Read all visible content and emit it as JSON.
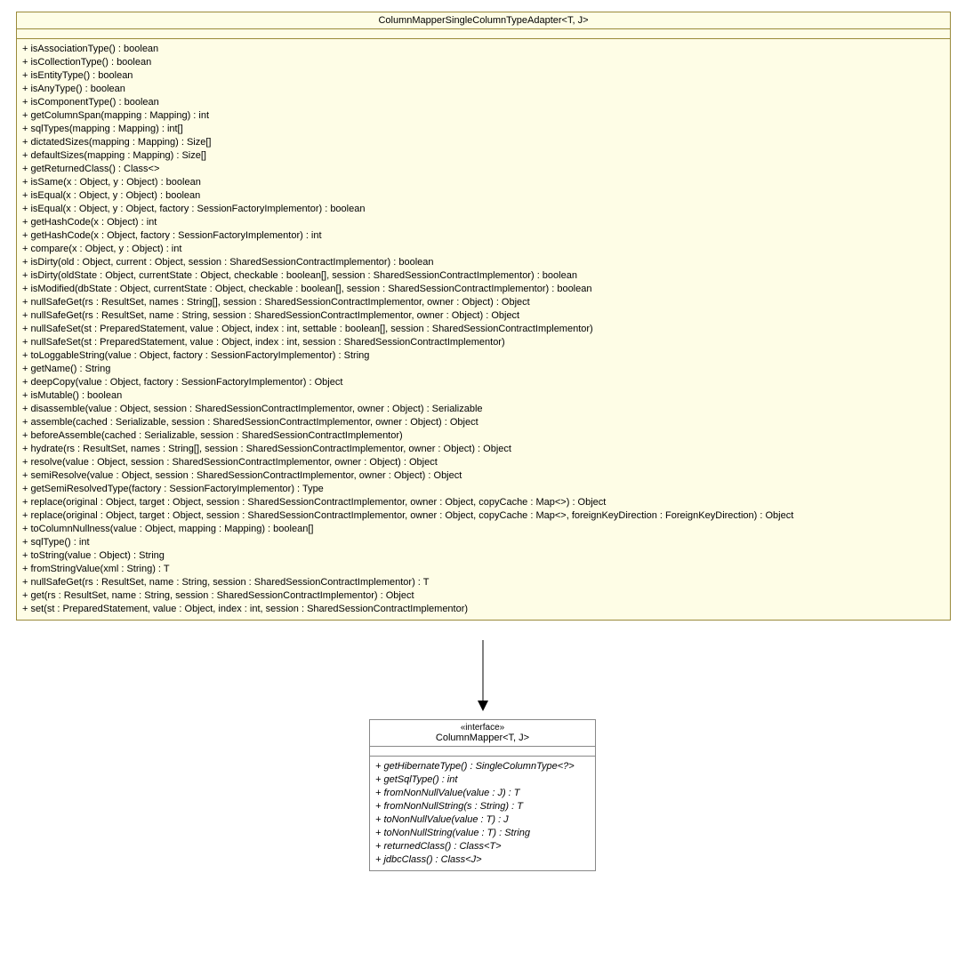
{
  "classBox": {
    "title": "ColumnMapperSingleColumnTypeAdapter<T, J>",
    "methods": [
      "+ isAssociationType() : boolean",
      "+ isCollectionType() : boolean",
      "+ isEntityType() : boolean",
      "+ isAnyType() : boolean",
      "+ isComponentType() : boolean",
      "+ getColumnSpan(mapping : Mapping) : int",
      "+ sqlTypes(mapping : Mapping) : int[]",
      "+ dictatedSizes(mapping : Mapping) : Size[]",
      "+ defaultSizes(mapping : Mapping) : Size[]",
      "+ getReturnedClass() : Class<>",
      "+ isSame(x : Object, y : Object) : boolean",
      "+ isEqual(x : Object, y : Object) : boolean",
      "+ isEqual(x : Object, y : Object, factory : SessionFactoryImplementor) : boolean",
      "+ getHashCode(x : Object) : int",
      "+ getHashCode(x : Object, factory : SessionFactoryImplementor) : int",
      "+ compare(x : Object, y : Object) : int",
      "+ isDirty(old : Object, current : Object, session : SharedSessionContractImplementor) : boolean",
      "+ isDirty(oldState : Object, currentState : Object, checkable : boolean[], session : SharedSessionContractImplementor) : boolean",
      "+ isModified(dbState : Object, currentState : Object, checkable : boolean[], session : SharedSessionContractImplementor) : boolean",
      "+ nullSafeGet(rs : ResultSet, names : String[], session : SharedSessionContractImplementor, owner : Object) : Object",
      "+ nullSafeGet(rs : ResultSet, name : String, session : SharedSessionContractImplementor, owner : Object) : Object",
      "+ nullSafeSet(st : PreparedStatement, value : Object, index : int, settable : boolean[], session : SharedSessionContractImplementor)",
      "+ nullSafeSet(st : PreparedStatement, value : Object, index : int, session : SharedSessionContractImplementor)",
      "+ toLoggableString(value : Object, factory : SessionFactoryImplementor) : String",
      "+ getName() : String",
      "+ deepCopy(value : Object, factory : SessionFactoryImplementor) : Object",
      "+ isMutable() : boolean",
      "+ disassemble(value : Object, session : SharedSessionContractImplementor, owner : Object) : Serializable",
      "+ assemble(cached : Serializable, session : SharedSessionContractImplementor, owner : Object) : Object",
      "+ beforeAssemble(cached : Serializable, session : SharedSessionContractImplementor)",
      "+ hydrate(rs : ResultSet, names : String[], session : SharedSessionContractImplementor, owner : Object) : Object",
      "+ resolve(value : Object, session : SharedSessionContractImplementor, owner : Object) : Object",
      "+ semiResolve(value : Object, session : SharedSessionContractImplementor, owner : Object) : Object",
      "+ getSemiResolvedType(factory : SessionFactoryImplementor) : Type",
      "+ replace(original : Object, target : Object, session : SharedSessionContractImplementor, owner : Object, copyCache : Map<>) : Object",
      "+ replace(original : Object, target : Object, session : SharedSessionContractImplementor, owner : Object, copyCache : Map<>, foreignKeyDirection : ForeignKeyDirection) : Object",
      "+ toColumnNullness(value : Object, mapping : Mapping) : boolean[]",
      "+ sqlType() : int",
      "+ toString(value : Object) : String",
      "+ fromStringValue(xml : String) : T",
      "+ nullSafeGet(rs : ResultSet, name : String, session : SharedSessionContractImplementor) : T",
      "+ get(rs : ResultSet, name : String, session : SharedSessionContractImplementor) : Object",
      "+ set(st : PreparedStatement, value : Object, index : int, session : SharedSessionContractImplementor)"
    ]
  },
  "interfaceBox": {
    "stereotype": "«interface»",
    "title": "ColumnMapper<T, J>",
    "methods": [
      "+ getHibernateType() : SingleColumnType<?>",
      "+ getSqlType() : int",
      "+ fromNonNullValue(value : J) : T",
      "+ fromNonNullString(s : String) : T",
      "+ toNonNullValue(value : T) : J",
      "+ toNonNullString(value : T) : String",
      "+ returnedClass() : Class<T>",
      "+ jdbcClass() : Class<J>"
    ]
  }
}
